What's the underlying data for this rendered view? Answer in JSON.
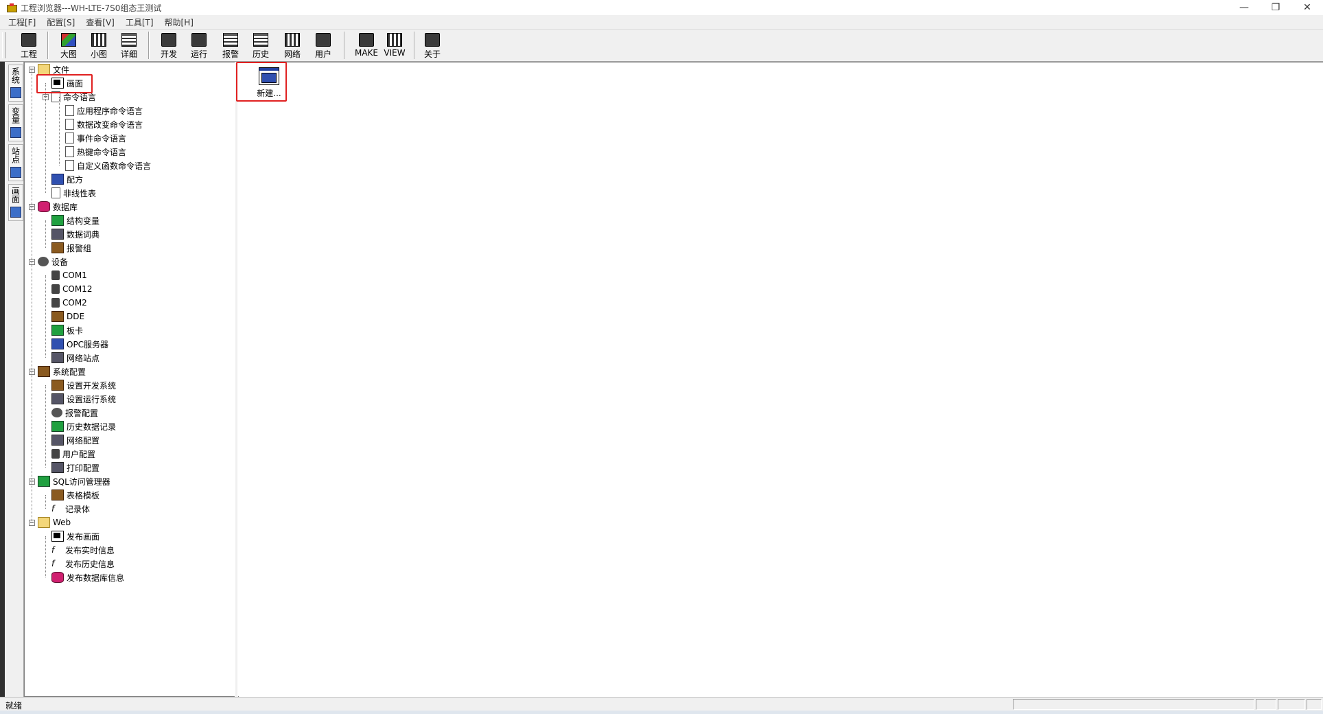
{
  "window": {
    "title": "工程浏览器---WH-LTE-7S0组态王测试",
    "controls": [
      "—",
      "❐",
      "✕"
    ]
  },
  "menu": [
    "工程[F]",
    "配置[S]",
    "查看[V]",
    "工具[T]",
    "帮助[H]"
  ],
  "toolbar": [
    {
      "label": "工程",
      "icon": "project-icon"
    },
    {
      "label": "大图",
      "icon": "large-icons-icon"
    },
    {
      "label": "小图",
      "icon": "small-icons-icon"
    },
    {
      "label": "详细",
      "icon": "details-icon"
    },
    {
      "label": "开发",
      "icon": "develop-icon"
    },
    {
      "label": "运行",
      "icon": "run-icon"
    },
    {
      "label": "报警",
      "icon": "alarm-icon"
    },
    {
      "label": "历史",
      "icon": "history-icon"
    },
    {
      "label": "网络",
      "icon": "network-icon"
    },
    {
      "label": "用户",
      "icon": "user-icon"
    },
    {
      "label": "MAKE",
      "icon": "make-icon"
    },
    {
      "label": "VIEW",
      "icon": "view-icon"
    },
    {
      "label": "关于",
      "icon": "about-icon"
    }
  ],
  "sidetabs": [
    "系统",
    "变量",
    "站点",
    "画面"
  ],
  "tree": [
    {
      "label": "文件",
      "level": 0,
      "expander": "⊟",
      "icon": "folder-icon"
    },
    {
      "label": "画面",
      "level": 1,
      "icon": "screen-icon"
    },
    {
      "label": "命令语言",
      "level": 1,
      "expander": "⊟",
      "icon": "document-icon"
    },
    {
      "label": "应用程序命令语言",
      "level": 2,
      "icon": "document-icon"
    },
    {
      "label": "数据改变命令语言",
      "level": 2,
      "icon": "document-icon"
    },
    {
      "label": "事件命令语言",
      "level": 2,
      "icon": "document-icon"
    },
    {
      "label": "热键命令语言",
      "level": 2,
      "icon": "document-icon"
    },
    {
      "label": "自定义函数命令语言",
      "level": 2,
      "icon": "document-icon"
    },
    {
      "label": "配方",
      "level": 1,
      "icon": "recipe-icon"
    },
    {
      "label": "非线性表",
      "level": 1,
      "icon": "table-icon"
    },
    {
      "label": "数据库",
      "level": 0,
      "expander": "⊟",
      "icon": "database-icon"
    },
    {
      "label": "结构变量",
      "level": 1,
      "icon": "struct-icon"
    },
    {
      "label": "数据词典",
      "level": 1,
      "icon": "dictionary-icon"
    },
    {
      "label": "报警组",
      "level": 1,
      "icon": "alarm-group-icon"
    },
    {
      "label": "设备",
      "level": 0,
      "expander": "⊟",
      "icon": "device-icon"
    },
    {
      "label": "COM1",
      "level": 1,
      "icon": "plug-icon"
    },
    {
      "label": "COM12",
      "level": 1,
      "icon": "plug-icon"
    },
    {
      "label": "COM2",
      "level": 1,
      "icon": "plug-icon"
    },
    {
      "label": "DDE",
      "level": 1,
      "icon": "dde-icon"
    },
    {
      "label": "板卡",
      "level": 1,
      "icon": "board-icon"
    },
    {
      "label": "OPC服务器",
      "level": 1,
      "icon": "opc-icon"
    },
    {
      "label": "网络站点",
      "level": 1,
      "icon": "network-icon"
    },
    {
      "label": "系统配置",
      "level": 0,
      "expander": "⊟",
      "icon": "tools-icon"
    },
    {
      "label": "设置开发系统",
      "level": 1,
      "icon": "dev-setup-icon"
    },
    {
      "label": "设置运行系统",
      "level": 1,
      "icon": "run-setup-icon"
    },
    {
      "label": "报警配置",
      "level": 1,
      "icon": "alarm-config-icon"
    },
    {
      "label": "历史数据记录",
      "level": 1,
      "icon": "history-icon"
    },
    {
      "label": "网络配置",
      "level": 1,
      "icon": "network-icon"
    },
    {
      "label": "用户配置",
      "level": 1,
      "icon": "user-icon"
    },
    {
      "label": "打印配置",
      "level": 1,
      "icon": "printer-icon"
    },
    {
      "label": "SQL访问管理器",
      "level": 0,
      "expander": "⊟",
      "icon": "sql-icon"
    },
    {
      "label": "表格模板",
      "level": 1,
      "icon": "template-icon"
    },
    {
      "label": "记录体",
      "level": 1,
      "icon": "function-icon"
    },
    {
      "label": "Web",
      "level": 0,
      "expander": "⊟",
      "icon": "folder-icon"
    },
    {
      "label": "发布画面",
      "level": 1,
      "icon": "screen-icon"
    },
    {
      "label": "发布实时信息",
      "level": 1,
      "icon": "function-icon"
    },
    {
      "label": "发布历史信息",
      "level": 1,
      "icon": "function-icon"
    },
    {
      "label": "发布数据库信息",
      "level": 1,
      "icon": "database-icon"
    }
  ],
  "content": {
    "new_item_label": "新建..."
  },
  "status": {
    "text": "就绪"
  }
}
